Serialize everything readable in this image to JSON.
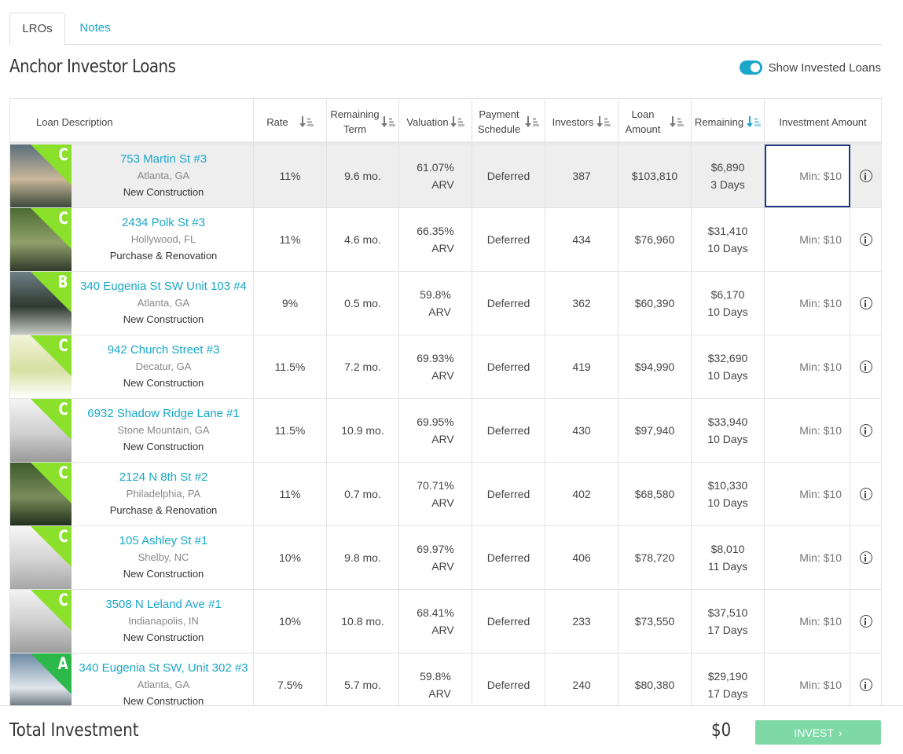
{
  "tabs": [
    {
      "label": "LROs",
      "active": true
    },
    {
      "label": "Notes",
      "active": false
    }
  ],
  "page_title": "Anchor Investor Loans",
  "toggle": {
    "label": "Show Invested Loans",
    "on": true
  },
  "columns": {
    "description": "Loan Description",
    "rate": "Rate",
    "term_line1": "Remaining",
    "term_line2": "Term",
    "valuation": "Valuation",
    "schedule_line1": "Payment",
    "schedule_line2": "Schedule",
    "investors": "Investors",
    "amount_line1": "Loan",
    "amount_line2": "Amount",
    "remaining": "Remaining",
    "investment": "Investment Amount"
  },
  "loans": [
    {
      "grade": "C",
      "name": "753 Martin St #3",
      "location": "Atlanta, GA",
      "type": "New Construction",
      "rate": "11%",
      "term": "9.6 mo.",
      "valuation": "61.07%",
      "valuation_basis": "ARV",
      "schedule": "Deferred",
      "investors": "387",
      "amount": "$103,810",
      "remaining": "$6,890",
      "days": "3 Days",
      "placeholder": "Min: $10"
    },
    {
      "grade": "C",
      "name": "2434 Polk St #3",
      "location": "Hollywood, FL",
      "type": "Purchase & Renovation",
      "rate": "11%",
      "term": "4.6 mo.",
      "valuation": "66.35%",
      "valuation_basis": "ARV",
      "schedule": "Deferred",
      "investors": "434",
      "amount": "$76,960",
      "remaining": "$31,410",
      "days": "10 Days",
      "placeholder": "Min: $10"
    },
    {
      "grade": "B",
      "name": "340 Eugenia St SW Unit 103 #4",
      "location": "Atlanta, GA",
      "type": "New Construction",
      "rate": "9%",
      "term": "0.5 mo.",
      "valuation": "59.8%",
      "valuation_basis": "ARV",
      "schedule": "Deferred",
      "investors": "362",
      "amount": "$60,390",
      "remaining": "$6,170",
      "days": "10 Days",
      "placeholder": "Min: $10"
    },
    {
      "grade": "C",
      "name": "942 Church Street #3",
      "location": "Decatur, GA",
      "type": "New Construction",
      "rate": "11.5%",
      "term": "7.2 mo.",
      "valuation": "69.93%",
      "valuation_basis": "ARV",
      "schedule": "Deferred",
      "investors": "419",
      "amount": "$94,990",
      "remaining": "$32,690",
      "days": "10 Days",
      "placeholder": "Min: $10"
    },
    {
      "grade": "C",
      "name": "6932 Shadow Ridge Lane #1",
      "location": "Stone Mountain, GA",
      "type": "New Construction",
      "rate": "11.5%",
      "term": "10.9 mo.",
      "valuation": "69.95%",
      "valuation_basis": "ARV",
      "schedule": "Deferred",
      "investors": "430",
      "amount": "$97,940",
      "remaining": "$33,940",
      "days": "10 Days",
      "placeholder": "Min: $10"
    },
    {
      "grade": "C",
      "name": "2124 N 8th St #2",
      "location": "Philadelphia, PA",
      "type": "Purchase & Renovation",
      "rate": "11%",
      "term": "0.7 mo.",
      "valuation": "70.71%",
      "valuation_basis": "ARV",
      "schedule": "Deferred",
      "investors": "402",
      "amount": "$68,580",
      "remaining": "$10,330",
      "days": "10 Days",
      "placeholder": "Min: $10"
    },
    {
      "grade": "C",
      "name": "105 Ashley St #1",
      "location": "Shelby, NC",
      "type": "New Construction",
      "rate": "10%",
      "term": "9.8 mo.",
      "valuation": "69.97%",
      "valuation_basis": "ARV",
      "schedule": "Deferred",
      "investors": "406",
      "amount": "$78,720",
      "remaining": "$8,010",
      "days": "11 Days",
      "placeholder": "Min: $10"
    },
    {
      "grade": "C",
      "name": "3508 N Leland Ave #1",
      "location": "Indianapolis, IN",
      "type": "New Construction",
      "rate": "10%",
      "term": "10.8 mo.",
      "valuation": "68.41%",
      "valuation_basis": "ARV",
      "schedule": "Deferred",
      "investors": "233",
      "amount": "$73,550",
      "remaining": "$37,510",
      "days": "17 Days",
      "placeholder": "Min: $10"
    },
    {
      "grade": "A",
      "name": "340 Eugenia St SW, Unit 302 #3",
      "location": "Atlanta, GA",
      "type": "New Construction",
      "rate": "7.5%",
      "term": "5.7 mo.",
      "valuation": "59.8%",
      "valuation_basis": "ARV",
      "schedule": "Deferred",
      "investors": "240",
      "amount": "$80,380",
      "remaining": "$29,190",
      "days": "17 Days",
      "placeholder": "Min: $10"
    }
  ],
  "footer": {
    "total_label": "Total Investment",
    "total_value": "$0",
    "invest_label": "INVEST"
  },
  "colors": {
    "accent": "#1aa7c9",
    "grade": "#8ae02a",
    "grade_a": "#2db84a",
    "invest_button": "#7ed9a6",
    "selected_border": "#1a3a7c"
  }
}
